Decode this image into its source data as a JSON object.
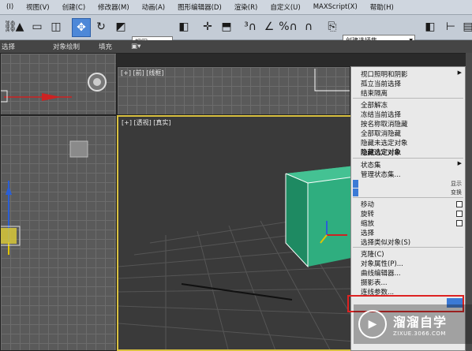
{
  "menubar": {
    "items": [
      "(I)",
      "视图(V)",
      "创建(C)",
      "修改器(M)",
      "动画(A)",
      "图形编辑器(D)",
      "渲染(R)",
      "自定义(U)",
      "MAXScript(X)",
      "帮助(H)"
    ]
  },
  "toolbar": {
    "view_dropdown": "视图",
    "selection_set_dropdown": "创建选择集"
  },
  "ribbon": {
    "items": [
      "选择",
      "对象绘制",
      "填充"
    ]
  },
  "viewports": {
    "top_right_label": "[+] [前] [线框]",
    "perspective_label": "[+] [透视] [真实]"
  },
  "context_menu": {
    "items": [
      {
        "label": "视口照明和阴影",
        "submenu": true
      },
      {
        "label": "孤立当前选择"
      },
      {
        "label": "结束隔离"
      },
      {
        "label": "全部解冻"
      },
      {
        "label": "冻结当前选择"
      },
      {
        "label": "按名称取消隐藏"
      },
      {
        "label": "全部取消隐藏"
      },
      {
        "label": "隐藏未选定对象"
      },
      {
        "label": "隐藏选定对象"
      },
      {
        "label": "状态集",
        "submenu": true
      },
      {
        "label": "管理状态集..."
      },
      {
        "label": "移动"
      },
      {
        "label": "旋转"
      },
      {
        "label": "缩放"
      },
      {
        "label": "选择"
      },
      {
        "label": "选择类似对象(S)"
      },
      {
        "label": "克隆(C)"
      },
      {
        "label": "对象属性(P)..."
      },
      {
        "label": "曲线编辑器..."
      },
      {
        "label": "摄影表..."
      },
      {
        "label": "连线参数..."
      }
    ],
    "side_labels": {
      "display": "显示",
      "transform": "变换"
    }
  },
  "watermark": {
    "brand": "溜溜自学",
    "url": "ZIXUE.3066.COM"
  },
  "colors": {
    "box": "#2fae7f",
    "selection_highlight": "#d22222",
    "accent": "#3b7ad6"
  }
}
